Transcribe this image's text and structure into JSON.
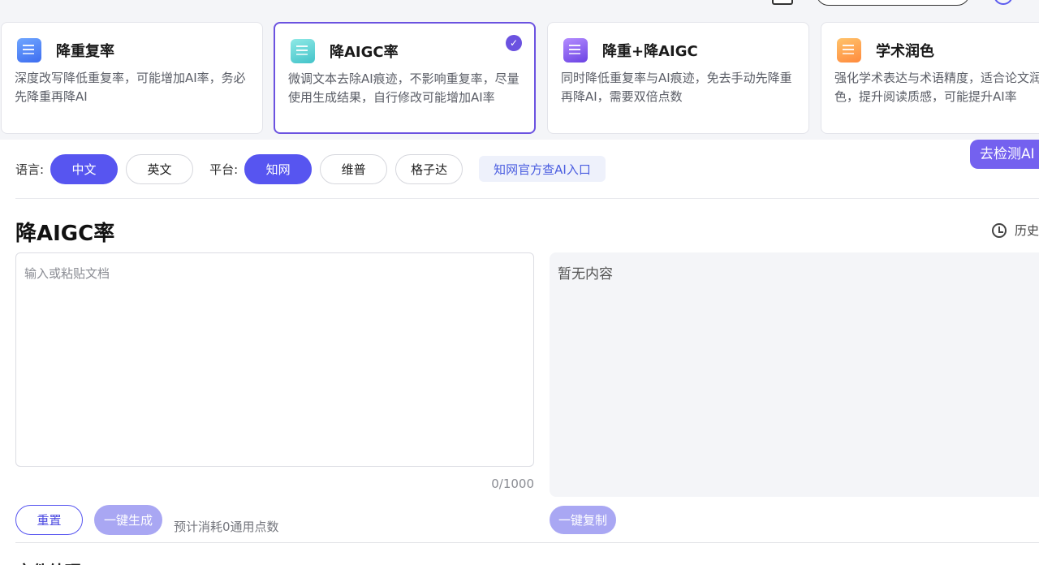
{
  "modes": [
    {
      "title": "降重复率",
      "desc": "深度改写降低重复率，可能增加AI率，务必先降重再降AI",
      "icon": "doc-down-icon",
      "selected": false
    },
    {
      "title": "降AIGC率",
      "desc": "微调文本去除AI痕迹，不影响重复率，尽量使用生成结果，自行修改可能增加AI率",
      "icon": "ai-doc-icon",
      "selected": true
    },
    {
      "title": "降重+降AIGC",
      "desc": "同时降低重复率与AI痕迹，免去手动先降重再降AI，需要双倍点数",
      "icon": "ai-doc-down-icon",
      "selected": false
    },
    {
      "title": "学术润色",
      "desc": "强化学术表达与术语精度，适合论文润色，提升阅读质感，可能提升AI率",
      "icon": "pen-edit-icon",
      "selected": false
    }
  ],
  "options": {
    "language_label": "语言:",
    "languages": [
      "中文",
      "英文"
    ],
    "language_selected": "中文",
    "platform_label": "平台:",
    "platforms": [
      "知网",
      "维普",
      "格子达"
    ],
    "platform_selected": "知网",
    "official_link": "知网官方查AI入口"
  },
  "detect_tab": "去检测AI",
  "page_title": "降AIGC率",
  "history_label": "历史",
  "input": {
    "placeholder": "输入或粘贴文档",
    "value": "",
    "char_count": "0/1000"
  },
  "output": {
    "empty_text": "暂无内容"
  },
  "buttons": {
    "reset": "重置",
    "generate": "一键生成",
    "copy": "一键复制"
  },
  "cost_note": "预计消耗0通用点数",
  "bottom_section": "文件处理",
  "colors": {
    "accent": "#5755f0",
    "accent_light": "#a9a7f3",
    "selected_border": "#6b52e0"
  }
}
